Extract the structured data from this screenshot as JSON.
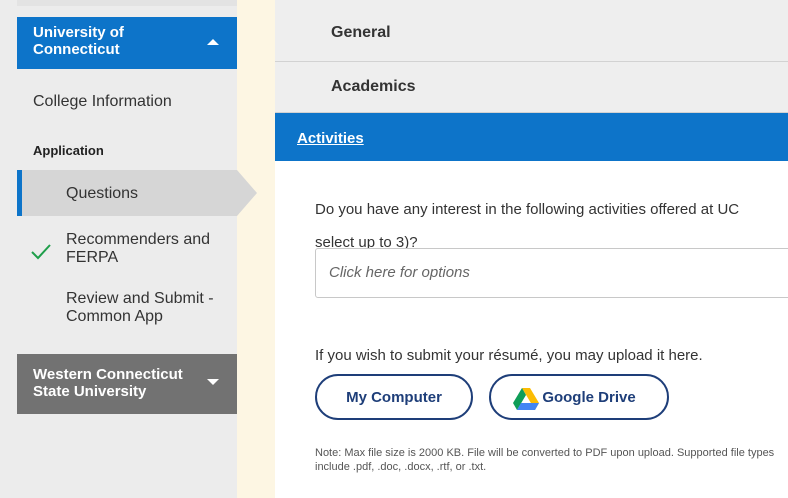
{
  "sidebar": {
    "university_header": "University of\nConnecticut",
    "college_information": "College Information",
    "section_application": "Application",
    "items": [
      {
        "label": "Questions"
      },
      {
        "label": "Recommenders and FERPA"
      },
      {
        "label": "Review and Submit - Common App"
      }
    ],
    "second_university": "Western Connecticut\nState University"
  },
  "main": {
    "sections": [
      {
        "label": "General"
      },
      {
        "label": "Academics"
      },
      {
        "label": "Activities"
      }
    ],
    "question": "Do you have any interest in the following activities offered at UC\nselect up to 3)?",
    "options_placeholder": "Click here for options",
    "resume_label": "If you wish to submit your résumé, you may upload it here.",
    "my_computer_button": "My Computer",
    "google_drive_button": "Google Drive",
    "note": "Note: Max file size is 2000 KB. File will be converted to PDF upon upload. Supported file types include .pdf, .doc, .docx, .rtf, or .txt."
  },
  "colors": {
    "accent_blue": "#0d74c9",
    "button_navy": "#1e3e79",
    "sidebar_gray": "#727272",
    "check_green": "#1e9e4a"
  },
  "icons": {
    "expand": "chevron-up-icon",
    "collapse": "chevron-down-icon",
    "completed": "check-icon",
    "drive": "google-drive-icon"
  }
}
